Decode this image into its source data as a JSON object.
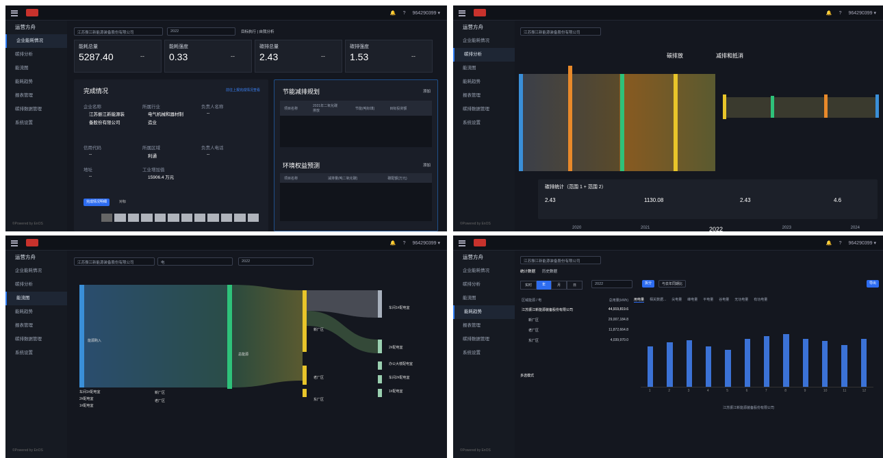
{
  "app": {
    "user": "964290399 ▾",
    "powered": "©Powered by EnOS"
  },
  "p1": {
    "side": [
      "运营方舟",
      "企业能耗情况",
      "碳排分析",
      "能流图",
      "能耗趋势",
      "报表管理",
      "碳排数据管理",
      "系统设置"
    ],
    "company_select": "江苏振江新能源装备股份有限公司",
    "year": "2022",
    "tabs": "目标执行  |  自我分析",
    "kpis": [
      {
        "label": "能耗总量",
        "value": "5287.40",
        "dash": "--"
      },
      {
        "label": "能耗强度",
        "value": "0.33",
        "dash": "--"
      },
      {
        "label": "碳排总量",
        "value": "2.43",
        "dash": "--"
      },
      {
        "label": "碳排强度",
        "value": "1.53",
        "dash": "--"
      }
    ],
    "done": {
      "title": "完成情况",
      "link": "前往上报完成情况查看",
      "c1": "企业名称",
      "v1": "江苏振江新能源装备股份有限公司",
      "c2": "所属行业",
      "v2": "电气机械和器材制造业",
      "c3": "负责人名称",
      "v3": "--",
      "c4": "信用代码",
      "v4": "--",
      "c5": "所属区域",
      "v5": "利通",
      "c6": "负责人电话",
      "v6": "--",
      "c7": "地址",
      "v7": "--",
      "c8": "工业增加值",
      "v8": "15906.4 万元",
      "b1": "完成情况明细",
      "b2": "对标"
    },
    "plan": {
      "title": "节能减排规划",
      "add": "添加",
      "col1": "项目名称",
      "col2": "2021年二氧化碳排放",
      "col3": "节能(吨标煤)",
      "col4": "目标投资额"
    },
    "env": {
      "title": "环境权益预测",
      "add": "添加",
      "col1": "项目名称",
      "col2": "减排量(吨二氧化碳)",
      "col3": "碳配额(万元)"
    }
  },
  "p2": {
    "company_select": "江苏振江新能源装备股份有限公司",
    "legend1": "碳排放",
    "legend2": "减排和抵消",
    "stat_title": "碳排统计（范围 1 + 范围 2）",
    "s1": "2.43",
    "s2": "1130.08",
    "s3": "2.43",
    "s4": "4.6",
    "years": [
      "2020",
      "2021",
      "2022",
      "2023",
      "2024"
    ]
  },
  "p3": {
    "company_select": "江苏振江新能源装备股份有限公司",
    "type_select": "电",
    "year_select": "2022",
    "n_in": "能源购入",
    "n_mid": "总能源",
    "n_f1": "新厂区",
    "n_f2": "老厂区",
    "n_f3": "东厂区",
    "n_out": [
      "车间1#配电室",
      "2#配电室",
      "办公大楼配电室",
      "车间2#配电室",
      "1#配电室"
    ],
    "leg": [
      "车间1#配电室",
      "2#配电室",
      "1#配电室"
    ],
    "leg2": [
      "新厂区",
      "老厂区"
    ]
  },
  "p4": {
    "company_select": "江苏振江新能源装备股份有限公司",
    "tabs": [
      "统计数据",
      "历史数据"
    ],
    "periods": [
      "实时",
      "年",
      "月",
      "日"
    ],
    "year": "2022",
    "btn1": "拆分",
    "btn2": "与去年同期比",
    "export": "导出",
    "table_header": [
      "区域能源 / 电",
      "总用量(kWh)"
    ],
    "metric_tabs": [
      "用电量",
      "相关数据...",
      "尖电量",
      "峰电量",
      "平电量",
      "谷电量",
      "无功电量",
      "有功电量"
    ],
    "rows": [
      {
        "name": "江苏振江新能源装备股份有限公司",
        "val": "44,919,819.6"
      },
      {
        "name": "新厂区",
        "val": "29,007,184.8"
      },
      {
        "name": "老厂区",
        "val": "11,872,664.8"
      },
      {
        "name": "东厂区",
        "val": "4,039,970.0"
      }
    ],
    "multi": "多选模式",
    "legend": "江苏振江新能源装备股份有限公司"
  },
  "chart_data": {
    "type": "bar",
    "categories": [
      "1",
      "2",
      "3",
      "4",
      "5",
      "6",
      "7",
      "8",
      "9",
      "10",
      "11",
      "12"
    ],
    "series": [
      {
        "name": "江苏振江新能源装备股份有限公司",
        "values": [
          3.3,
          3.6,
          3.8,
          3.3,
          3.0,
          3.9,
          4.1,
          4.3,
          3.9,
          3.7,
          3.4,
          3.9
        ]
      }
    ],
    "color": "#3b72d6"
  }
}
